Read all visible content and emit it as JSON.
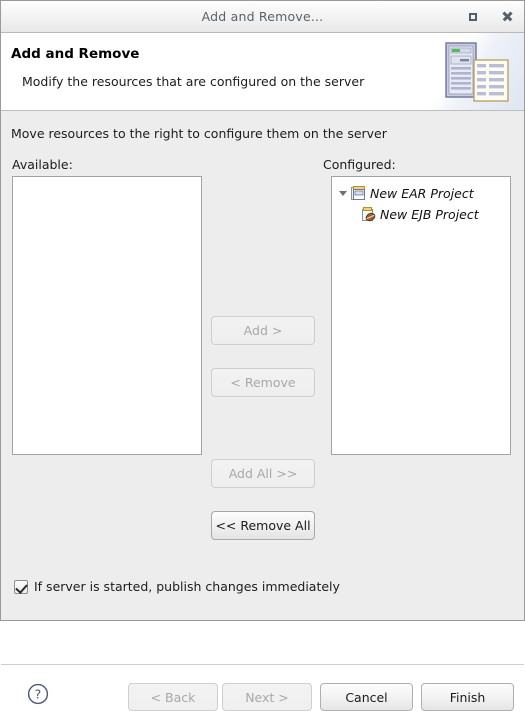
{
  "window": {
    "title": "Add and Remove...",
    "maximize_icon": "maximize-icon",
    "close_icon": "close-icon"
  },
  "header": {
    "title": "Add and Remove",
    "subtitle": "Modify the resources that are configured on the server",
    "icon": "server-and-document-icon"
  },
  "main": {
    "instruction": "Move resources to the right to configure them on the server",
    "available_label": "Available:",
    "configured_label": "Configured:",
    "available_items": [],
    "configured_tree": [
      {
        "label": "New EAR Project",
        "icon": "ear-archive-icon",
        "expanded": true,
        "expander_icon": "chevron-down-icon",
        "children": [
          {
            "label": "New EJB Project",
            "icon": "ejb-bean-icon"
          }
        ]
      }
    ],
    "transfer_buttons": [
      {
        "label": "Add >",
        "enabled": false
      },
      {
        "label": "< Remove",
        "enabled": false
      },
      {
        "label": "Add All >>",
        "enabled": false
      },
      {
        "label": "<< Remove All",
        "enabled": true
      }
    ],
    "publish_checkbox": {
      "label": "If server is started, publish changes immediately",
      "checked": true
    }
  },
  "footer": {
    "help_icon": "help-question-icon",
    "buttons": [
      {
        "label": "< Back",
        "enabled": false
      },
      {
        "label": "Next >",
        "enabled": false
      },
      {
        "label": "Cancel",
        "enabled": true
      },
      {
        "label": "Finish",
        "enabled": true
      }
    ]
  },
  "colors": {
    "dialog_background": "#ededed",
    "header_background": "#ffffff",
    "title_text": "#59626b",
    "list_background": "#ffffff",
    "border": "#a4a4a4",
    "disabled_text": "#a8a8a8",
    "help_icon": "#4a5a74",
    "ear_icon_accent": "#e3b84a",
    "ejb_bean": "#8a5a2b"
  }
}
